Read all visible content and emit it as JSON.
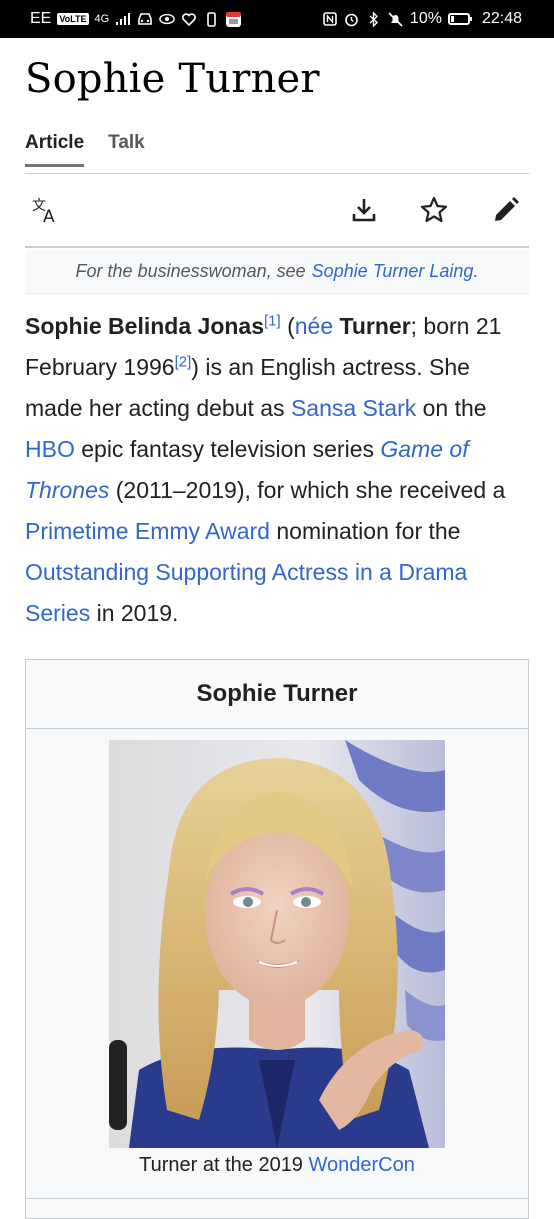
{
  "status_bar": {
    "carrier": "EE",
    "volte": "VoLTE",
    "network": "4G",
    "battery": "10%",
    "time": "22:48"
  },
  "page": {
    "title": "Sophie Turner",
    "tabs": [
      {
        "label": "Article",
        "active": true
      },
      {
        "label": "Talk",
        "active": false
      }
    ],
    "actions": [
      "language-icon",
      "download-icon",
      "star-icon",
      "edit-icon"
    ]
  },
  "hatnote": {
    "prefix": "For the businesswoman, see",
    "link": "Sophie Turner Laing."
  },
  "lead": {
    "name": "Sophie Belinda Jonas",
    "ref1": "[1]",
    "open_paren": " (",
    "nee": "née",
    "maiden": "Turner",
    "born_text": "; born 21 February 1996",
    "ref2": "[2]",
    "s1_end": ") is an English actress. She made her acting debut as ",
    "sansa": "Sansa Stark",
    "on_the": " on the ",
    "hbo": "HBO",
    "epic": " epic fantasy television series ",
    "got": "Game of Thrones",
    "years": " (2011–2019), for which she received a ",
    "emmy": "Primetime Emmy Award",
    "nomination": " nomination for the ",
    "category": "Outstanding Supporting Actress in a Drama Series",
    "end": " in 2019."
  },
  "infobox": {
    "title": "Sophie Turner",
    "caption_prefix": "Turner at the 2019 ",
    "caption_link": "WonderCon"
  },
  "colors": {
    "link": "#3366cc",
    "text": "#202122",
    "muted": "#54595d",
    "border": "#c8ccd1",
    "panel": "#f8f9fa"
  }
}
